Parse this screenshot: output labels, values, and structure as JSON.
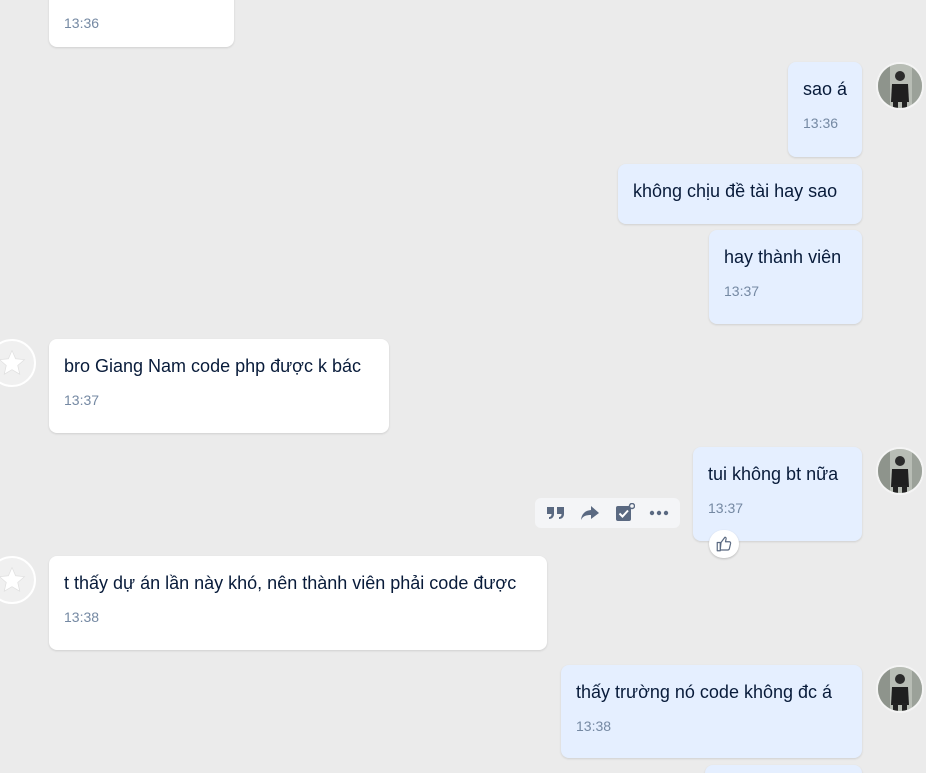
{
  "messages": [
    {
      "id": "m0",
      "dir": "in",
      "text": "",
      "time": "13:36"
    },
    {
      "id": "m1",
      "dir": "out",
      "text": "sao á",
      "time": "13:36"
    },
    {
      "id": "m2",
      "dir": "out",
      "text": "không chịu đề tài hay sao",
      "time": ""
    },
    {
      "id": "m3",
      "dir": "out",
      "text": "hay thành viên",
      "time": "13:37"
    },
    {
      "id": "m4",
      "dir": "in",
      "text": "bro Giang Nam code php được k bác",
      "time": "13:37"
    },
    {
      "id": "m5",
      "dir": "out",
      "text": "tui không bt nữa",
      "time": "13:37"
    },
    {
      "id": "m6",
      "dir": "in",
      "text": "t thấy dự án lần này khó, nên thành viên phải code được",
      "time": "13:38"
    },
    {
      "id": "m7",
      "dir": "out",
      "text": "thấy trường nó code không đc á",
      "time": "13:38"
    }
  ],
  "message_actions": {
    "icons": [
      "quote-icon",
      "forward-icon",
      "mark-task-icon",
      "more-icon"
    ]
  },
  "reaction": {
    "icon": "thumbs-up-icon"
  },
  "colors": {
    "background": "#ebebeb",
    "incoming_bubble": "#ffffff",
    "outgoing_bubble": "#e5efff",
    "text": "#081b3a",
    "timestamp": "#7589a3",
    "icon": "#5a6981"
  }
}
